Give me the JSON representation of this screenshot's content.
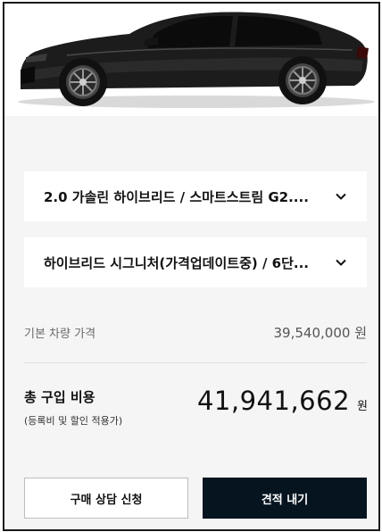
{
  "options": {
    "engine_label": "2.0 가솔린 하이브리드 / 스마트스트림 G2....",
    "trim_label": "하이브리드 시그니처(가격업데이트중) / 6단..."
  },
  "price": {
    "base_label": "기본 차량 가격",
    "base_value": "39,540,000",
    "base_unit": "원",
    "total_label": "총 구입 비용",
    "total_note": "(등록비 및 할인 적용가)",
    "total_value": "41,941,662",
    "total_unit": "원"
  },
  "actions": {
    "consult_label": "구매 상담 신청",
    "quote_label": "견적 내기"
  },
  "colors": {
    "primary_dark": "#05141f",
    "background": "#f5f5f5"
  },
  "icons": {
    "dropdown": "chevron-down-icon"
  }
}
